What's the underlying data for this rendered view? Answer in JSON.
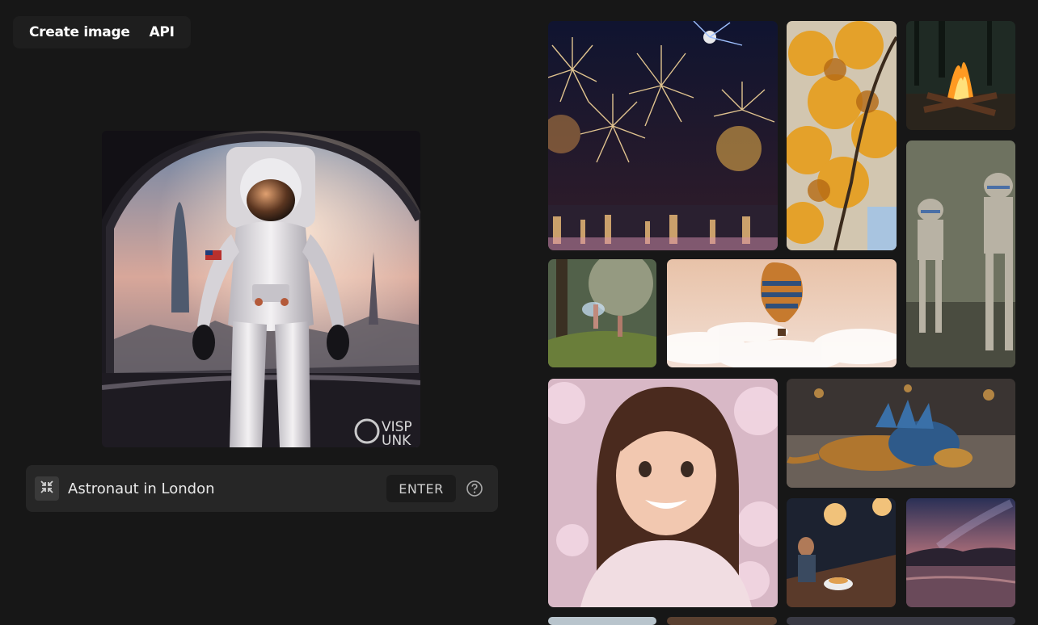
{
  "nav": {
    "tabs": [
      {
        "label": "Create image"
      },
      {
        "label": "API"
      }
    ]
  },
  "preview": {
    "watermark_line1": "VISP",
    "watermark_line2": "UNK"
  },
  "prompt": {
    "value": "Astronaut in London",
    "enter_label": "ENTER"
  },
  "icons": {
    "collapse": "collapse-arrows-icon",
    "help": "question-circle-icon"
  },
  "gallery": {
    "images": [
      {
        "subject": "fireworks"
      },
      {
        "subject": "autumn-leaves"
      },
      {
        "subject": "campfire"
      },
      {
        "subject": "fairies-forest"
      },
      {
        "subject": "hot-air-balloon"
      },
      {
        "subject": "robots"
      },
      {
        "subject": "smiling-girl-blossoms"
      },
      {
        "subject": "blue-dragon"
      },
      {
        "subject": "night-diner"
      },
      {
        "subject": "night-sky-lake"
      }
    ]
  }
}
